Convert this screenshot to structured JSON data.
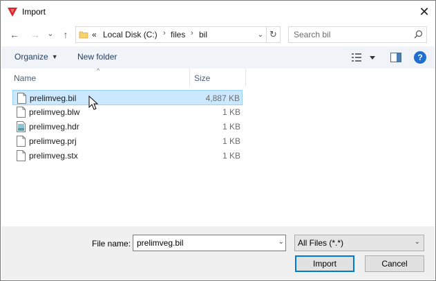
{
  "window": {
    "title": "Import",
    "close_glyph": "✕",
    "icon": "app-red-triangle-icon",
    "accent": "#0078d7"
  },
  "nav": {
    "back_glyph": "←",
    "forward_glyph": "→",
    "recent_glyph": "⌄",
    "up_glyph": "↑",
    "breadcrumb_overflow": "«",
    "breadcrumbs": [
      "Local Disk (C:)",
      "files",
      "bil"
    ],
    "separator": "›",
    "address_dropdown_glyph": "⌄",
    "refresh_glyph": "↻",
    "search_placeholder": "Search bil"
  },
  "toolbar": {
    "organize_label": "Organize",
    "new_folder_label": "New folder",
    "help_label": "?"
  },
  "columns": {
    "name": "Name",
    "size": "Size",
    "sort_indicator": "^"
  },
  "files": [
    {
      "name": "prelimveg.bil",
      "size": "4,887 KB",
      "selected": true,
      "icon": "blank-file-icon"
    },
    {
      "name": "prelimveg.blw",
      "size": "1 KB",
      "selected": false,
      "icon": "blank-file-icon"
    },
    {
      "name": "prelimveg.hdr",
      "size": "1 KB",
      "selected": false,
      "icon": "image-file-icon"
    },
    {
      "name": "prelimveg.prj",
      "size": "1 KB",
      "selected": false,
      "icon": "blank-file-icon"
    },
    {
      "name": "prelimveg.stx",
      "size": "1 KB",
      "selected": false,
      "icon": "blank-file-icon"
    }
  ],
  "bottom": {
    "file_name_label": "File name:",
    "file_name_value": "prelimveg.bil",
    "file_type_value": "All Files (*.*)",
    "dropdown_glyph": "⌄",
    "import_label": "Import",
    "cancel_label": "Cancel"
  }
}
